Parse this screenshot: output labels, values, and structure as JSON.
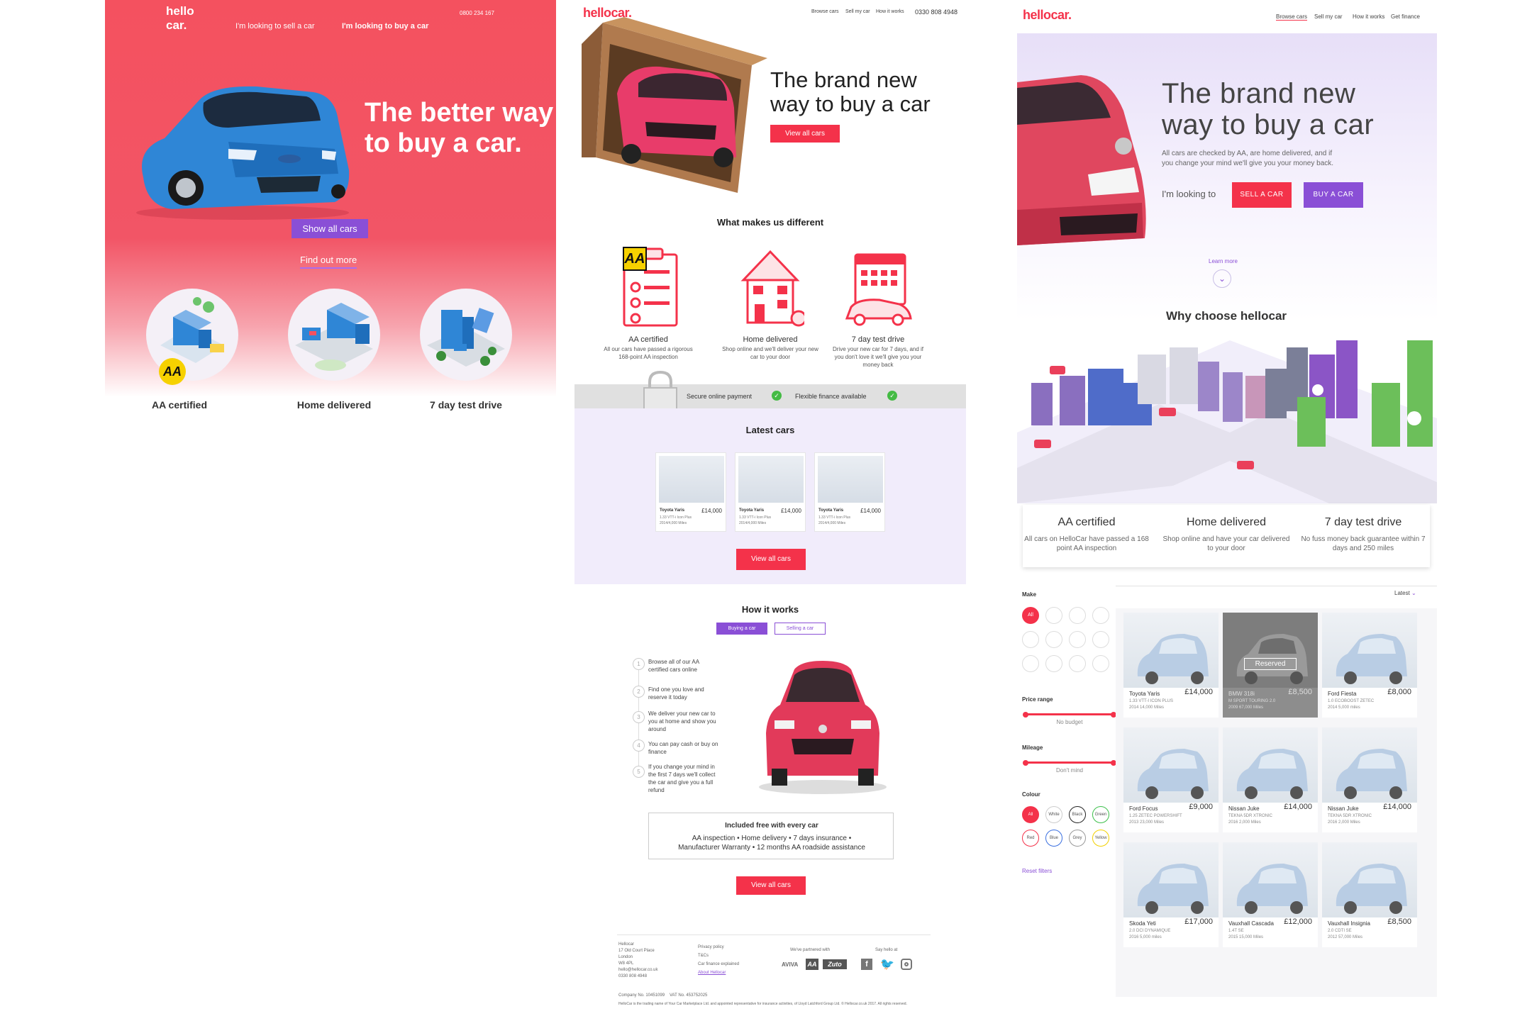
{
  "panel1": {
    "logo": "hello car.",
    "phone": "0800 234 167",
    "nav": [
      "I'm looking to sell a car",
      "I'm looking to buy a car"
    ],
    "title_line1": "The better way",
    "title_line2": "to buy a car.",
    "button": "Show all cars",
    "link": "Find out more",
    "aa_badge": "AA",
    "features": [
      "AA certified",
      "Home delivered",
      "7 day test drive"
    ],
    "colors": {
      "hero": "#f4515f",
      "button": "#8a4fd6"
    }
  },
  "panel2": {
    "logo": "hellocar.",
    "nav": [
      "Browse cars",
      "Sell my car",
      "How it works"
    ],
    "phone": "0330 808 4948",
    "title_line1": "The brand new",
    "title_line2": "way to buy a car",
    "hero_button": "View all cars",
    "different_heading": "What makes us different",
    "aa_badge": "AA",
    "features": [
      {
        "title": "AA certified",
        "sub": "All our cars have passed a rigorous 168-point AA inspection"
      },
      {
        "title": "Home delivered",
        "sub": "Shop online and we'll deliver your new car to your door"
      },
      {
        "title": "7 day test drive",
        "sub": "Drive your new car for 7 days, and if you don't love it we'll give you your money back"
      }
    ],
    "band": [
      "Secure online payment",
      "Flexible finance available"
    ],
    "latest_heading": "Latest cars",
    "cards": [
      {
        "name": "Toyota Yaris",
        "price": "£14,000",
        "sub1": "1.33 VTT-i Icon Plus",
        "sub2": "2014/4,000 Miles"
      },
      {
        "name": "Toyota Yaris",
        "price": "£14,000",
        "sub1": "1.33 VTT-i Icon Plus",
        "sub2": "2014/4,000 Miles"
      },
      {
        "name": "Toyota Yaris",
        "price": "£14,000",
        "sub1": "1.33 VTT-i Icon Plus",
        "sub2": "2014/4,000 Miles"
      }
    ],
    "latest_button": "View all cars",
    "how_heading": "How it works",
    "tabs": [
      "Buying a car",
      "Selling a car"
    ],
    "steps": [
      {
        "n": "1",
        "text": "Browse all of our AA certified cars online"
      },
      {
        "n": "2",
        "text": "Find one you love and reserve it today"
      },
      {
        "n": "3",
        "text": "We deliver your new car to you at home and show you around"
      },
      {
        "n": "4",
        "text": "You can pay cash or buy on finance"
      },
      {
        "n": "5",
        "text": "If you change your mind in the first 7 days we'll collect the car and give you a full refund"
      }
    ],
    "included_title": "Included free with every car",
    "included_line1": "AA inspection  •  Home delivery  •  7 days insurance  •",
    "included_line2": "Manufacturer Warranty  •  12 months AA roadside assistance",
    "how_button": "View all cars",
    "footer": {
      "address": [
        "Hellocar",
        "17 Old Court Place",
        "London",
        "W8 4PL",
        "hello@hellocar.co.uk",
        "0330 808 4948"
      ],
      "links": [
        "Privacy policy",
        "T&Cs",
        "Car finance explained",
        "About Hellocar"
      ],
      "partnered": "We've partnered with",
      "partners": [
        "AVIVA",
        "AA",
        "Zuto"
      ],
      "say_hello": "Say hello at",
      "company_no": "Company No. 10451099",
      "vat_no": "VAT No. 453752025",
      "legal": "HelloCar is the trading name of Your Car Marketplace Ltd. and appointed representative for insurance activities, of Lloyd Latchford Group Ltd. © Hellocar.co.uk 2017. All rights reserved."
    }
  },
  "panel3": {
    "logo": "hellocar.",
    "nav": [
      "Browse cars",
      "Sell my car",
      "How it works",
      "Get finance"
    ],
    "title_line1": "The brand new",
    "title_line2": "way to buy a car",
    "sub": "All cars are checked by AA, are home delivered, and if you change your mind we'll give you your money back.",
    "looking": "I'm looking to",
    "sell_button": "SELL A CAR",
    "buy_button": "BUY A CAR",
    "learn_more": "Learn more",
    "why_heading": "Why choose hellocar",
    "features": [
      {
        "title": "AA certified",
        "sub": "All cars on HelloCar have passed a 168 point AA inspection"
      },
      {
        "title": "Home delivered",
        "sub": "Shop online and have your car delivered to your door"
      },
      {
        "title": "7 day test drive",
        "sub": "No fuss money back guarantee within 7 days and 250 miles"
      }
    ],
    "make_label": "Make",
    "make_all": "All",
    "price_label": "Price range",
    "price_value": "No budget",
    "mileage_label": "Mileage",
    "mileage_value": "Don't mind",
    "colour_label": "Colour",
    "colours": [
      {
        "name": "All",
        "color": "#f4324a"
      },
      {
        "name": "White",
        "color": "#cccccc"
      },
      {
        "name": "Black",
        "color": "#222222"
      },
      {
        "name": "Green",
        "color": "#3cbf4a"
      },
      {
        "name": "Red",
        "color": "#f4324a"
      },
      {
        "name": "Blue",
        "color": "#3a6fe0"
      },
      {
        "name": "Grey",
        "color": "#999999"
      },
      {
        "name": "Yellow",
        "color": "#f2d000"
      }
    ],
    "reset": "Reset filters",
    "sort": "Latest",
    "reserved": "Reserved",
    "cars": [
      {
        "name": "Toyota Yaris",
        "price": "£14,000",
        "sub1": "1.33 VTT-I ICON PLUS",
        "sub2": "2014 14,000 Miles"
      },
      {
        "name": "BMW 318i",
        "price": "£8,500",
        "sub1": "M SPORT TOURING 2.0",
        "sub2": "2009 67,000 Miles",
        "reserved": true
      },
      {
        "name": "Ford Fiesta",
        "price": "£8,000",
        "sub1": "1.0 ECOBOOST ZETEC",
        "sub2": "2014 5,000 miles"
      },
      {
        "name": "Ford Focus",
        "price": "£9,000",
        "sub1": "1.25 ZETEC POWERSHIFT",
        "sub2": "2013 23,000 Miles"
      },
      {
        "name": "Nissan Juke",
        "price": "£14,000",
        "sub1": "TEKNA 5DR XTRONIC",
        "sub2": "2016 2,000 Miles"
      },
      {
        "name": "Nissan Juke",
        "price": "£14,000",
        "sub1": "TEKNA 5DR XTRONIC",
        "sub2": "2016 2,000 Miles"
      },
      {
        "name": "Skoda Yeti",
        "price": "£17,000",
        "sub1": "2.0 DCI DYNAMIQUE",
        "sub2": "2016 5,000 miles"
      },
      {
        "name": "Vauxhall Cascada",
        "price": "£12,000",
        "sub1": "1.4T SE",
        "sub2": "2015 15,000 Miles"
      },
      {
        "name": "Vauxhall Insignia",
        "price": "£8,500",
        "sub1": "2.0 CDTI SE",
        "sub2": "2012 57,000 Miles"
      }
    ]
  }
}
